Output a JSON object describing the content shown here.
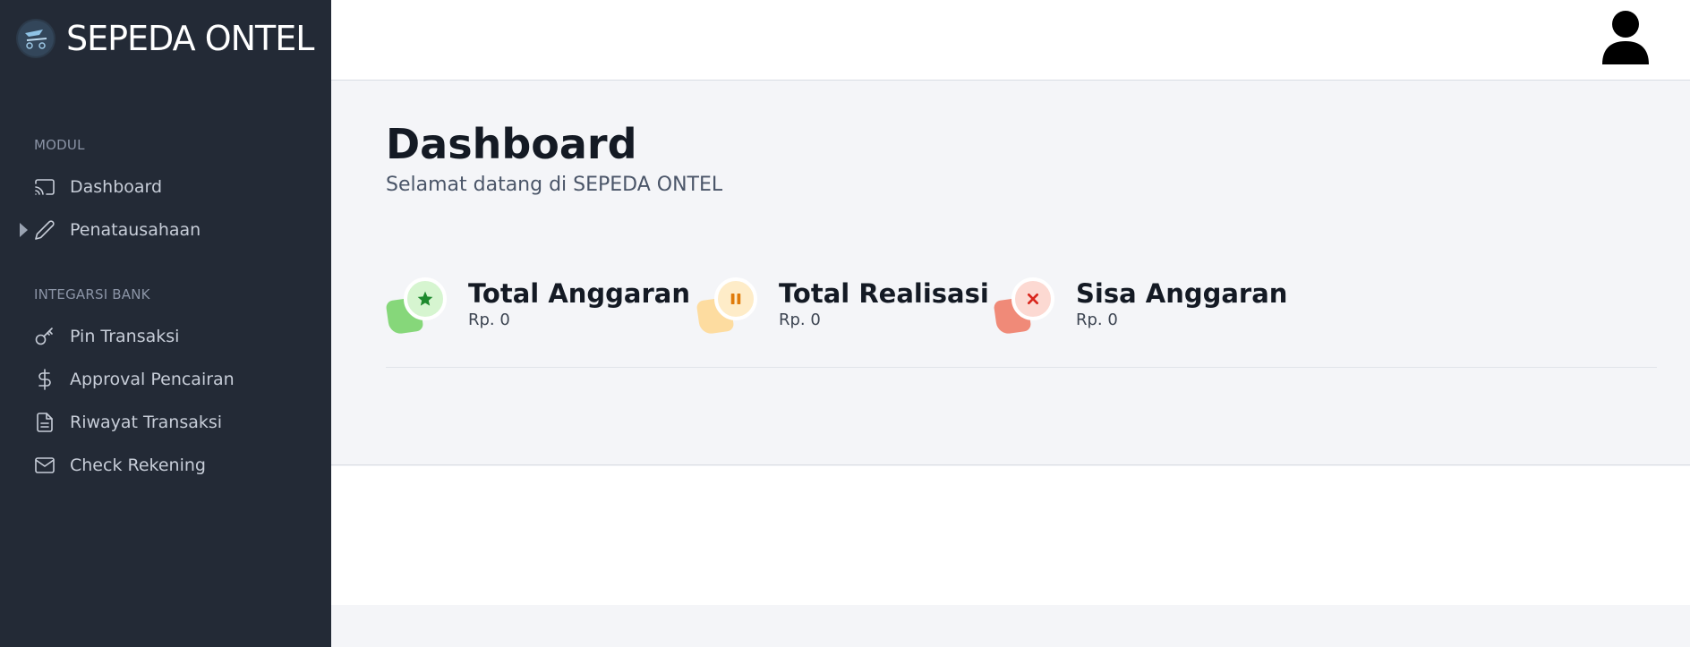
{
  "brand": {
    "title": "SEPEDA ONTEL",
    "logo_icon": "bicycle-logo-icon"
  },
  "sidebar": {
    "sections": [
      {
        "label": "MODUL",
        "items": [
          {
            "label": "Dashboard",
            "icon": "cast-icon"
          },
          {
            "label": "Penatausahaan",
            "icon": "pencil-icon",
            "expandable": true
          }
        ]
      },
      {
        "label": "INTEGARSI BANK",
        "items": [
          {
            "label": "Pin Transaksi",
            "icon": "key-icon"
          },
          {
            "label": "Approval Pencairan",
            "icon": "dollar-icon"
          },
          {
            "label": "Riwayat Transaksi",
            "icon": "document-icon"
          },
          {
            "label": "Check Rekening",
            "icon": "mail-icon"
          }
        ]
      }
    ]
  },
  "topbar": {
    "avatar_icon": "user-avatar-icon"
  },
  "main": {
    "title": "Dashboard",
    "subtitle": "Selamat datang di SEPEDA ONTEL",
    "stats": [
      {
        "label": "Total Anggaran",
        "value": "Rp. 0",
        "icon": "star-icon",
        "blob_color": "#86d77a",
        "circle_color": "#d6f5d0",
        "glyph_color": "#1e8a2e"
      },
      {
        "label": "Total Realisasi",
        "value": "Rp. 0",
        "icon": "pause-icon",
        "blob_color": "#fddca0",
        "circle_color": "#feecc8",
        "glyph_color": "#e07b0a"
      },
      {
        "label": "Sisa Anggaran",
        "value": "Rp. 0",
        "icon": "close-icon",
        "blob_color": "#f08a78",
        "circle_color": "#fcd9d2",
        "glyph_color": "#d9261c"
      }
    ]
  }
}
